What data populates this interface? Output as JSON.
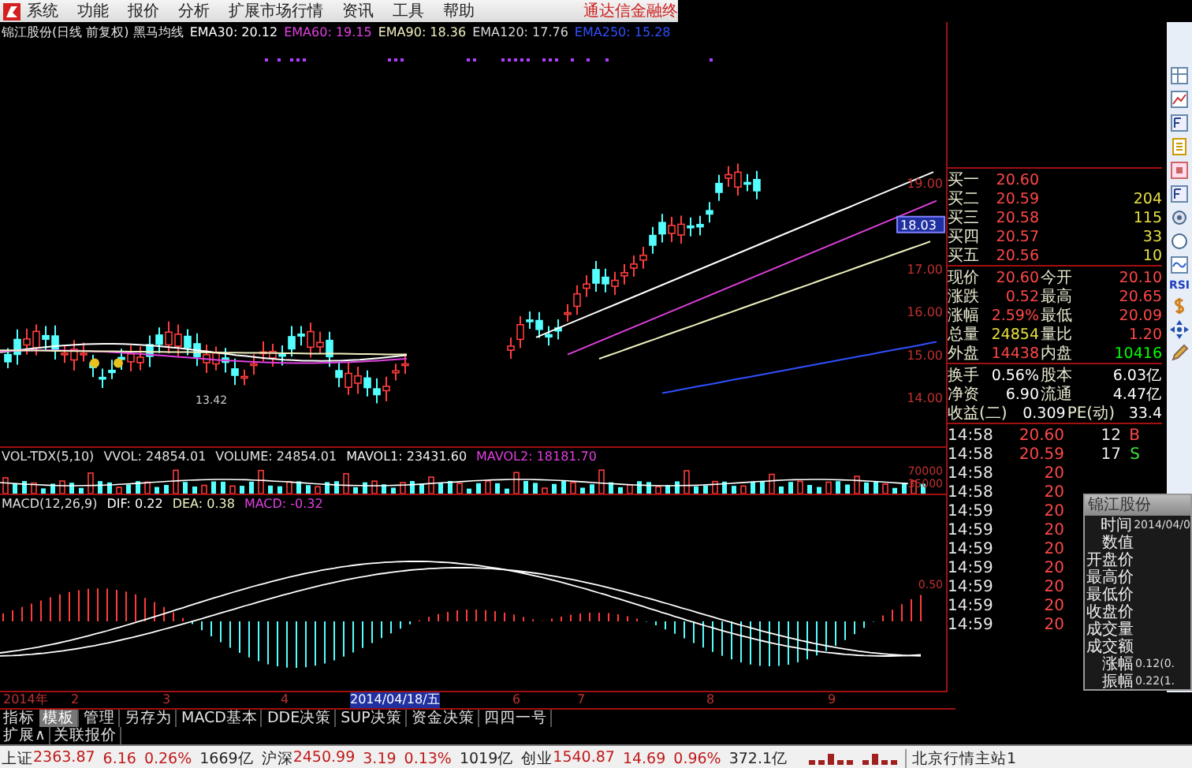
{
  "menu": {
    "items": [
      "系统",
      "功能",
      "报价",
      "分析",
      "扩展市场行情",
      "资讯",
      "工具",
      "帮助"
    ],
    "brand": "通达信金融终"
  },
  "kline": {
    "title": [
      {
        "text": "锦江股份(日线 前复权) 黑马均线",
        "color": "#e0e0e0"
      },
      {
        "text": "EMA30: 20.12",
        "color": "#ffffff"
      },
      {
        "text": "EMA60: 19.15",
        "color": "#e040e0"
      },
      {
        "text": "EMA90: 18.36",
        "color": "#f0f0c0"
      },
      {
        "text": "EMA120: 17.76",
        "color": "#d8d8d8"
      },
      {
        "text": "EMA250: 15.28",
        "color": "#3050ff"
      }
    ],
    "price_ticks": [
      "19.00",
      "17.00",
      "16.00",
      "15.00",
      "14.00"
    ],
    "cursor_price": "18.03",
    "low_label": "13.42"
  },
  "volume": {
    "title": [
      {
        "text": "VOL-TDX(5,10)",
        "color": "#e0e0e0"
      },
      {
        "text": "VVOL: 24854.01",
        "color": "#e0e0e0"
      },
      {
        "text": "VOLUME: 24854.01",
        "color": "#e0e0e0"
      },
      {
        "text": "MAVOL1: 23431.60",
        "color": "#f0f0f0"
      },
      {
        "text": "MAVOL2: 18181.70",
        "color": "#e040e0"
      }
    ],
    "ticks": [
      "70000",
      "35000"
    ]
  },
  "macd": {
    "title": [
      {
        "text": "MACD(12,26,9)",
        "color": "#e0e0e0"
      },
      {
        "text": "DIF: 0.22",
        "color": "#ffffff"
      },
      {
        "text": "DEA: 0.38",
        "color": "#f0f0c0"
      },
      {
        "text": "MACD: -0.32",
        "color": "#e040e0"
      }
    ],
    "ticks": [
      "0.50"
    ]
  },
  "quote": {
    "bids": [
      {
        "label": "买一",
        "price": "20.60"
      },
      {
        "label": "买二",
        "price": "20.59",
        "volume": "204"
      },
      {
        "label": "买三",
        "price": "20.58",
        "volume": "115"
      },
      {
        "label": "买四",
        "price": "20.57",
        "volume": "33"
      },
      {
        "label": "买五",
        "price": "20.56",
        "volume": "10"
      }
    ],
    "stats": [
      [
        {
          "label": "现价",
          "value": "20.60",
          "color": "#ff4848"
        },
        {
          "label": "今开",
          "value": "20.10",
          "color": "#ff4848"
        }
      ],
      [
        {
          "label": "涨跌",
          "value": "0.52",
          "color": "#ff4848"
        },
        {
          "label": "最高",
          "value": "20.65",
          "color": "#ff4848"
        }
      ],
      [
        {
          "label": "涨幅",
          "value": "2.59%",
          "color": "#ff4848"
        },
        {
          "label": "最低",
          "value": "20.09",
          "color": "#ff4848"
        }
      ],
      [
        {
          "label": "总量",
          "value": "24854",
          "color": "#e8e040"
        },
        {
          "label": "量比",
          "value": "1.20",
          "color": "#ff4848"
        }
      ],
      [
        {
          "label": "外盘",
          "value": "14438",
          "color": "#ff4848"
        },
        {
          "label": "内盘",
          "value": "10416",
          "color": "#00ff00"
        }
      ],
      [
        {
          "label": "换手",
          "value": "0.56%",
          "color": "#ffffff"
        },
        {
          "label": "股本",
          "value": "6.03亿",
          "color": "#ffffff"
        }
      ],
      [
        {
          "label": "净资",
          "value": "6.90",
          "color": "#ffffff"
        },
        {
          "label": "流通",
          "value": "4.47亿",
          "color": "#ffffff"
        }
      ],
      [
        {
          "label": "收益(二)",
          "value": "0.309",
          "color": "#ffffff"
        },
        {
          "label": "PE(动)",
          "value": "33.4",
          "color": "#ffffff"
        }
      ]
    ],
    "ticks": [
      {
        "time": "14:58",
        "price": "20.60",
        "volume": "12",
        "side": "B"
      },
      {
        "time": "14:58",
        "price": "20.59",
        "volume": "17",
        "side": "S"
      },
      {
        "time": "14:58",
        "price": "20"
      },
      {
        "time": "14:58",
        "price": "20"
      },
      {
        "time": "14:59",
        "price": "20"
      },
      {
        "time": "14:59",
        "price": "20"
      },
      {
        "time": "14:59",
        "price": "20"
      },
      {
        "time": "14:59",
        "price": "20"
      },
      {
        "time": "14:59",
        "price": "20"
      },
      {
        "time": "14:59",
        "price": "20"
      },
      {
        "time": "14:59",
        "price": "20"
      }
    ]
  },
  "side_toolbar": {
    "text_button": "RSI"
  },
  "popup": {
    "title": "锦江股份",
    "rows": [
      {
        "label": "时间",
        "value": "2014/04/0"
      },
      {
        "label": "数值"
      },
      {
        "label": "开盘价"
      },
      {
        "label": "最高价"
      },
      {
        "label": "最低价"
      },
      {
        "label": "收盘价"
      },
      {
        "label": "成交量"
      },
      {
        "label": "成交额"
      },
      {
        "label": "涨幅",
        "value": "0.12(0."
      },
      {
        "label": "振幅",
        "value": "0.22(1."
      }
    ]
  },
  "date_axis": [
    {
      "label": "2014年",
      "selected": false
    },
    {
      "label": "2",
      "selected": false
    },
    {
      "label": "3",
      "selected": false
    },
    {
      "label": "4",
      "selected": false
    },
    {
      "label": "2014/04/18/五",
      "selected": true
    },
    {
      "label": "6",
      "selected": false
    },
    {
      "label": "7",
      "selected": false
    },
    {
      "label": "8",
      "selected": false
    },
    {
      "label": "9",
      "selected": false
    }
  ],
  "tabs": {
    "caption": "指标",
    "items": [
      {
        "label": "模板",
        "selected": true
      },
      {
        "label": "管理",
        "selected": false
      },
      {
        "label": "另存为",
        "selected": false
      },
      {
        "label": "MACD基本",
        "selected": false
      },
      {
        "label": "DDE决策",
        "selected": false
      },
      {
        "label": "SUP决策",
        "selected": false
      },
      {
        "label": "资金决策",
        "selected": false
      },
      {
        "label": "四四一号",
        "selected": false
      }
    ]
  },
  "extra_bar": [
    "扩展∧",
    "关联报价"
  ],
  "status_bar": {
    "indices": [
      {
        "name": "上证",
        "value": "2363.87",
        "change": "6.16",
        "percent": "0.26%",
        "amount": "1669亿"
      },
      {
        "name": "沪深",
        "value": "2450.99",
        "change": "3.19",
        "percent": "0.13%",
        "amount": "1019亿"
      },
      {
        "name": "创业",
        "value": "1540.87",
        "change": "14.69",
        "percent": "0.96%",
        "amount": "372.1亿"
      }
    ],
    "server": "北京行情主站1"
  }
}
